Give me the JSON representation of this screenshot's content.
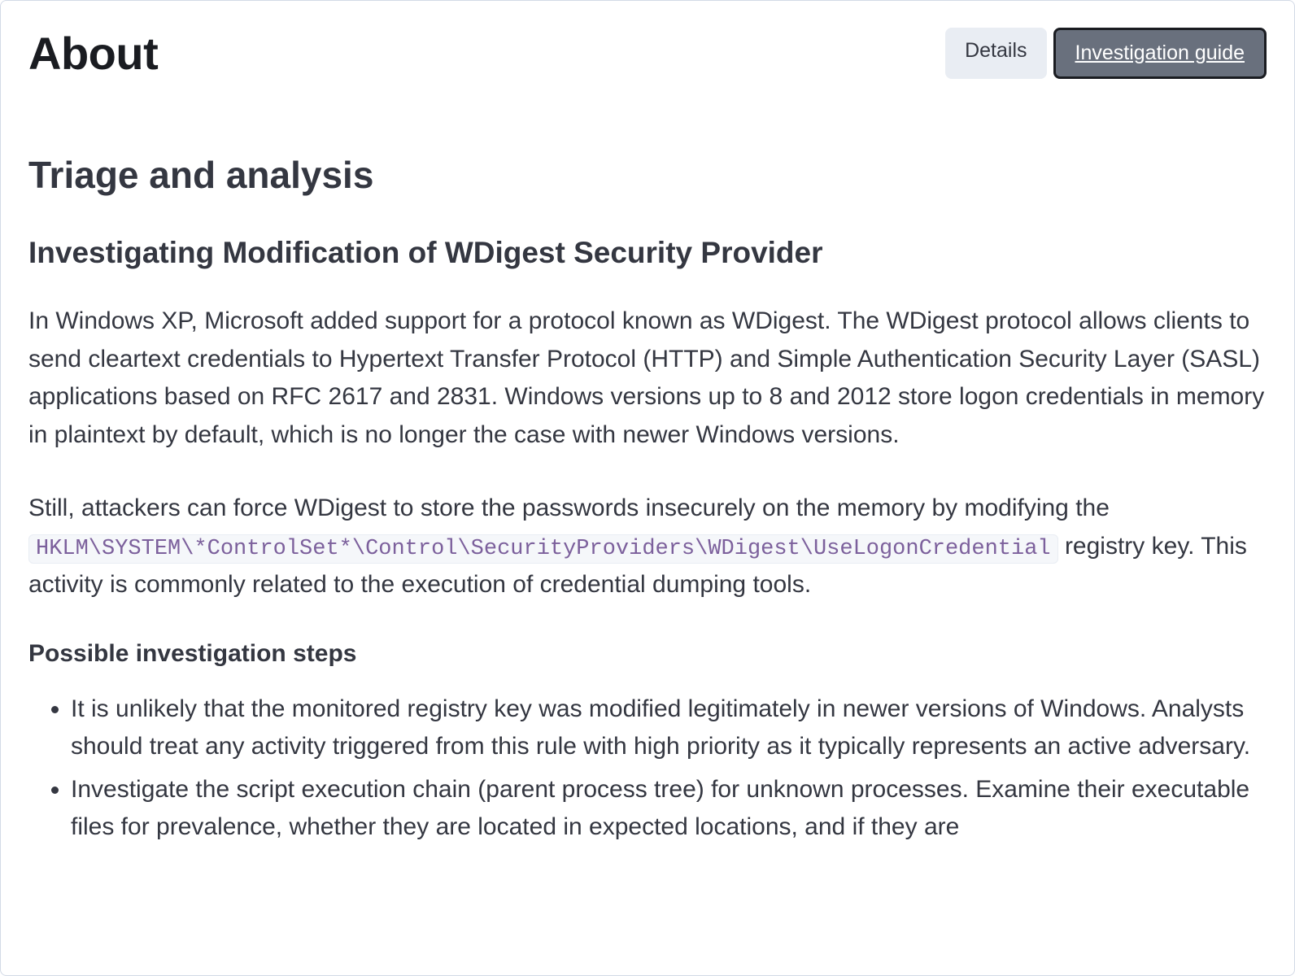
{
  "header": {
    "title": "About",
    "tabs": {
      "details": "Details",
      "investigation_guide": "Investigation guide"
    }
  },
  "content": {
    "section_title": "Triage and analysis",
    "subsection_title": "Investigating Modification of WDigest Security Provider",
    "para1": "In Windows XP, Microsoft added support for a protocol known as WDigest. The WDigest protocol allows clients to send cleartext credentials to Hypertext Transfer Protocol (HTTP) and Simple Authentication Security Layer (SASL) applications based on RFC 2617 and 2831. Windows versions up to 8 and 2012 store logon credentials in memory in plaintext by default, which is no longer the case with newer Windows versions.",
    "para2_pre": "Still, attackers can force WDigest to store the passwords insecurely on the memory by modifying the ",
    "para2_code": "HKLM\\SYSTEM\\*ControlSet*\\Control\\SecurityProviders\\WDigest\\UseLogonCredential",
    "para2_post": " registry key. This activity is commonly related to the execution of credential dumping tools.",
    "steps_title": "Possible investigation steps",
    "steps": [
      "It is unlikely that the monitored registry key was modified legitimately in newer versions of Windows. Analysts should treat any activity triggered from this rule with high priority as it typically represents an active adversary.",
      "Investigate the script execution chain (parent process tree) for unknown processes. Examine their executable files for prevalence, whether they are located in expected locations, and if they are"
    ]
  }
}
